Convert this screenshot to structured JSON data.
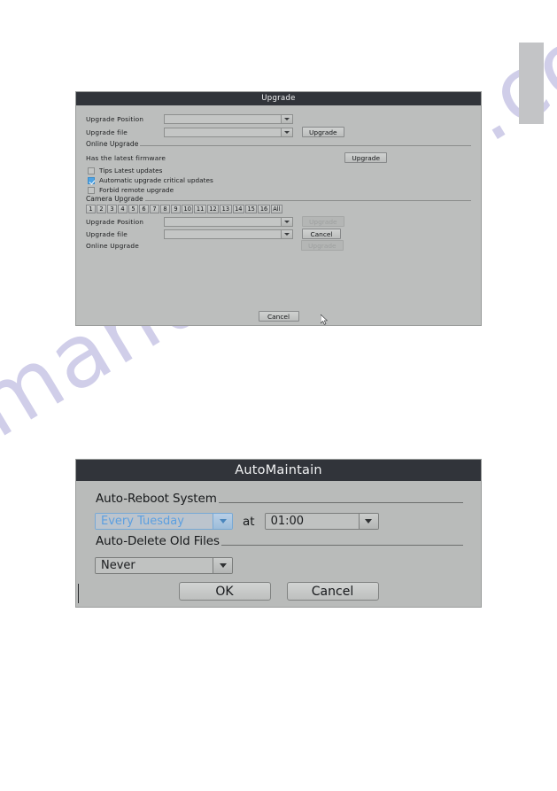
{
  "watermark": {
    "text": "manualshive.com"
  },
  "upgrade_dialog": {
    "title": "Upgrade",
    "upgrade_position_label": "Upgrade Position",
    "upgrade_position_value": "",
    "upgrade_file_label": "Upgrade file",
    "upgrade_file_value": "",
    "upgrade_button": "Upgrade",
    "online_upgrade_section": "Online Upgrade",
    "has_latest_firmware_label": "Has the latest firmware",
    "online_upgrade_button": "Upgrade",
    "checkboxes": [
      {
        "label": "Tips Latest updates",
        "checked": false
      },
      {
        "label": "Automatic upgrade critical updates",
        "checked": true
      },
      {
        "label": "Forbid remote upgrade",
        "checked": false
      }
    ],
    "camera_upgrade_section": "Camera Upgrade",
    "channels": [
      "1",
      "2",
      "3",
      "4",
      "5",
      "6",
      "7",
      "8",
      "9",
      "10",
      "11",
      "12",
      "13",
      "14",
      "15",
      "16",
      "All"
    ],
    "cam_position_label": "Upgrade Position",
    "cam_position_value": "",
    "cam_position_button": "Upgrade",
    "cam_file_label": "Upgrade file",
    "cam_file_value": "",
    "cam_file_button": "Cancel",
    "cam_online_label": "Online Upgrade",
    "cam_online_button": "Upgrade",
    "cancel_button": "Cancel"
  },
  "automaintain_dialog": {
    "title": "AutoMaintain",
    "auto_reboot_section": "Auto-Reboot System",
    "reboot_day_value": "Every Tuesday",
    "at_label": "at",
    "reboot_time_value": "01:00",
    "auto_delete_section": "Auto-Delete Old Files",
    "delete_value": "Never",
    "ok_button": "OK",
    "cancel_button": "Cancel"
  },
  "colors": {
    "titlebar": "#31343a",
    "dialog_bg": "#b9bbba",
    "checkbox_checked": "#4ea3e4",
    "focus_blue": "#5c9fe0",
    "watermark": "#7470be"
  }
}
